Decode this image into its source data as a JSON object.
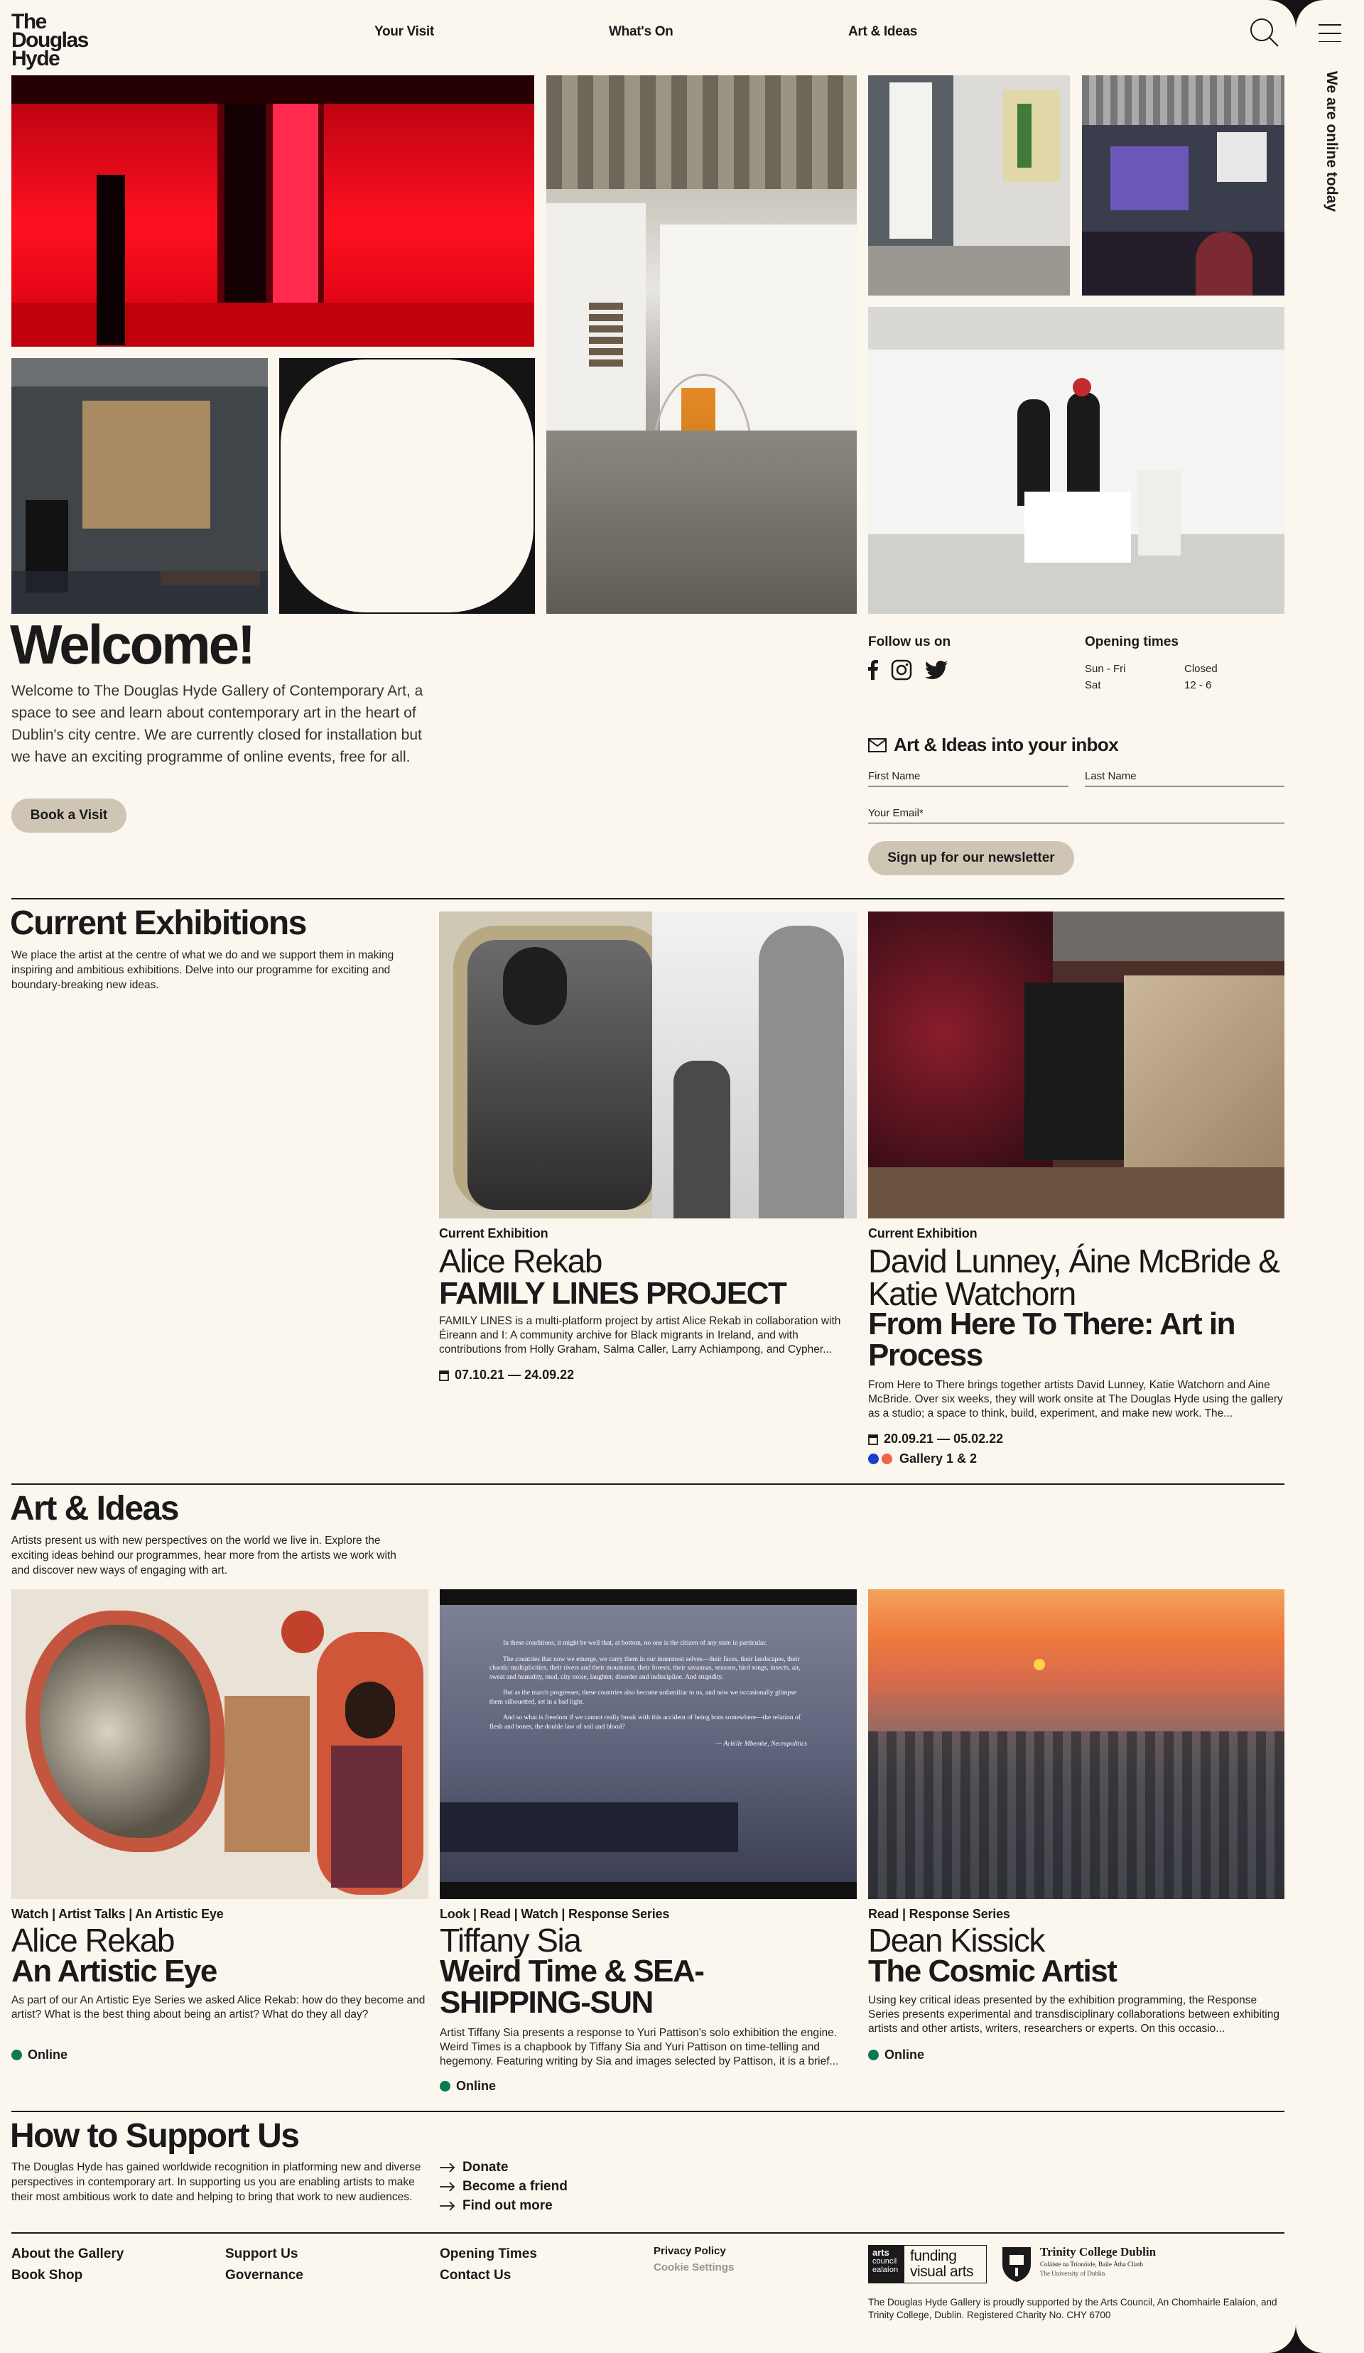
{
  "site": {
    "logo": "The Douglas Hyde"
  },
  "nav": {
    "items": [
      "Your Visit",
      "What's On",
      "Art & Ideas"
    ]
  },
  "rail": {
    "label": "We are online today"
  },
  "welcome": {
    "title": "Welcome!",
    "text": "Welcome to The Douglas Hyde Gallery of Contemporary Art, a space to see and learn about contemporary art in the heart of Dublin's city centre. We are currently closed for installation but we have an exciting programme of online events, free for all.",
    "button": "Book a Visit"
  },
  "follow": {
    "title": "Follow us on"
  },
  "hours": {
    "title": "Opening times",
    "rows": [
      {
        "day": "Sun - Fri",
        "time": "Closed"
      },
      {
        "day": "Sat",
        "time": "12 - 6"
      }
    ]
  },
  "newsletter": {
    "title": "Art & Ideas into your inbox",
    "first_name": "First Name",
    "last_name": "Last Name",
    "email": "Your Email*",
    "button": "Sign up for our newsletter"
  },
  "exhibitions": {
    "title": "Current Exhibitions",
    "text": "We place the artist at the centre of what we do and we support them in making inspiring and ambitious exhibitions. Delve into our programme for exciting and boundary-breaking new ideas.",
    "items": [
      {
        "kicker": "Current Exhibition",
        "artist": "Alice Rekab",
        "title": "FAMILY LINES PROJECT",
        "desc": "FAMILY LINES is a multi-platform project by artist Alice Rekab in collaboration with Éireann and I: A community archive for Black migrants in Ireland, and with contributions from Holly Graham, Salma Caller, Larry Achiampong, and Cypher...",
        "dates": "07.10.21 — 24.09.22",
        "location": ""
      },
      {
        "kicker": "Current Exhibition",
        "artist": "David Lunney, Áine McBride & Katie Watchorn",
        "title": "From Here To There: Art in Process",
        "desc": "From Here to There brings together artists David Lunney, Katie Watchorn and Aine McBride. Over six weeks, they will work onsite at The Douglas Hyde using the gallery as a studio; a space to think, build, experiment, and make new work. The...",
        "dates": "20.09.21 — 05.02.22",
        "location": "Gallery 1 & 2"
      }
    ]
  },
  "ideas": {
    "title": "Art & Ideas",
    "text": "Artists present us with new perspectives on the world we live in. Explore the exciting ideas behind our programmes, hear more from the artists we work with and discover new ways of engaging with art.",
    "items": [
      {
        "kicker": "Watch | Artist Talks | An Artistic Eye",
        "artist": "Alice Rekab",
        "title": "An Artistic Eye",
        "desc": "As part of our An Artistic Eye Series we asked Alice Rekab: how do they become and artist? What is the best thing about being an artist? What do they all day?",
        "status": "Online"
      },
      {
        "kicker": "Look | Read | Watch | Response Series",
        "artist": "Tiffany Sia",
        "title": "Weird Time & SEA-SHIPPING-SUN",
        "desc": "Artist Tiffany Sia presents a response to Yuri Pattison's solo exhibition the engine. Weird Times is a chapbook by Tiffany Sia and Yuri Pattison on time-telling and hegemony. Featuring writing by Sia and images selected by Pattison, it is a brief...",
        "status": "Online"
      },
      {
        "kicker": "Read | Response Series",
        "artist": "Dean Kissick",
        "title": "The Cosmic Artist",
        "desc": "Using key critical ideas presented by the exhibition programming, the Response Series presents experimental and transdisciplinary collaborations between exhibiting artists and other artists, writers, researchers or experts. On this occasio...",
        "status": "Online"
      }
    ],
    "quote": {
      "p1": "In these conditions, it might be well that, at bottom, no one is the citizen of any state in particular.",
      "p2": "The countries that now we emerge, we carry them in our innermost selves—their faces, their landscapes, their chaotic multiplicities, their rivers and their mountains, their forests, their savannas, seasons, bird songs, insects, air, sweat and humidity, mud, city noise, laughter, disorder and indiscipline. And stupidity.",
      "p3": "But as the march progresses, these countries also become unfamiliar to us, and now we occasionally glimpse them silhouetted, set in a bad light.",
      "p4": "And so what is freedom if we cannot really break with this accident of being born somewhere—the relation of flesh and bones, the double law of soil and blood?",
      "cite": "— Achille Mbembe, Necropolitics"
    }
  },
  "support": {
    "title": "How to Support Us",
    "text": "The Douglas Hyde has gained worldwide recognition in platforming new and diverse perspectives in contemporary art. In supporting us you are enabling artists to make their most ambitious work to date and helping to bring that work to new audiences.",
    "links": [
      "Donate",
      "Become a friend",
      "Find out more"
    ]
  },
  "footer": {
    "col1": [
      "About the Gallery",
      "Book Shop"
    ],
    "col2": [
      "Support Us",
      "Governance"
    ],
    "col3": [
      "Opening Times",
      "Contact Us"
    ],
    "privacy": "Privacy Policy",
    "cookies": "Cookie Settings",
    "arts_council": {
      "small": [
        "arts",
        "council",
        "ealaíon"
      ],
      "big": "funding visual arts"
    },
    "tcd": {
      "name": "Trinity College Dublin",
      "irish": "Coláiste na Tríonóide, Baile Átha Cliath",
      "sub": "The University of Dublin"
    },
    "credit": "The Douglas Hyde Gallery is proudly supported by the Arts Council, An Chomhairle Ealaíon, and Trinity College, Dublin. Registered Charity No. CHY 6700"
  },
  "colors": {
    "background": "#fbf6ee",
    "pill": "#cfc5b5",
    "online": "#0a7a55",
    "gallery1": "#1d3bc9",
    "gallery2": "#f0634a"
  }
}
